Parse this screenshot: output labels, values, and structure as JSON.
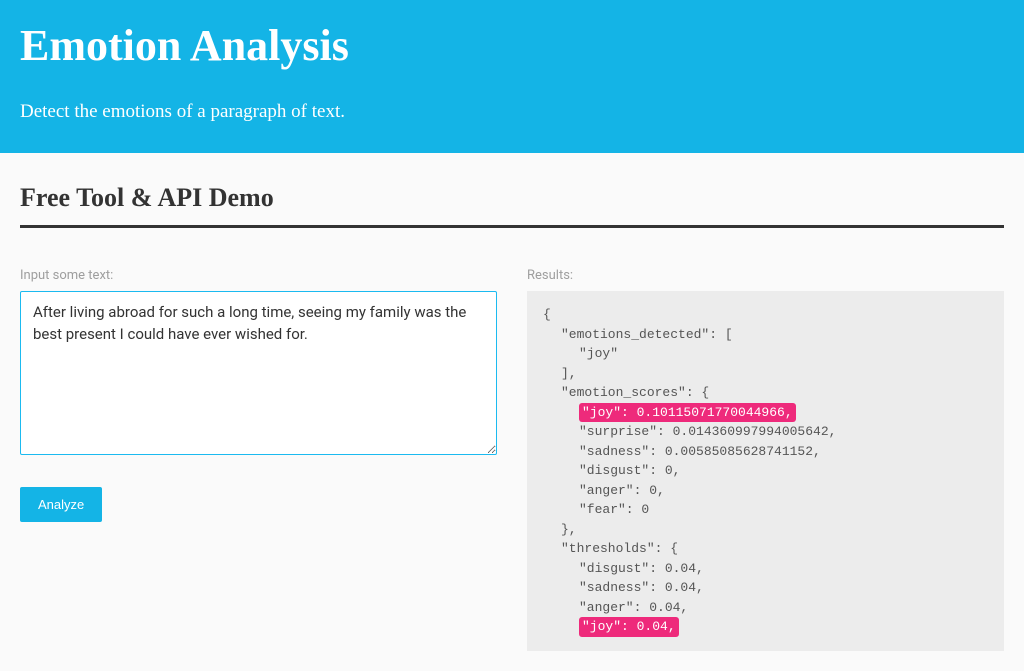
{
  "hero": {
    "title": "Emotion Analysis",
    "subtitle": "Detect the emotions of a paragraph of text."
  },
  "section_title": "Free Tool & API Demo",
  "input": {
    "label": "Input some text:",
    "value": "After living abroad for such a long time, seeing my family was the best present I could have ever wished for."
  },
  "analyze_label": "Analyze",
  "results": {
    "label": "Results:",
    "json": {
      "open": "{",
      "emotions_detected_key": "\"emotions_detected\": [",
      "emotions_detected_value": "\"joy\"",
      "emotions_detected_close": "],",
      "emotion_scores_key": "\"emotion_scores\": {",
      "emotion_scores": {
        "joy": "\"joy\": 0.10115071770044966,",
        "surprise": "\"surprise\": 0.014360997994005642,",
        "sadness": "\"sadness\": 0.00585085628741152,",
        "disgust": "\"disgust\": 0,",
        "anger": "\"anger\": 0,",
        "fear": "\"fear\": 0"
      },
      "emotion_scores_close": "},",
      "thresholds_key": "\"thresholds\": {",
      "thresholds": {
        "disgust": "\"disgust\": 0.04,",
        "sadness": "\"sadness\": 0.04,",
        "anger": "\"anger\": 0.04,",
        "joy": "\"joy\": 0.04,"
      }
    }
  }
}
